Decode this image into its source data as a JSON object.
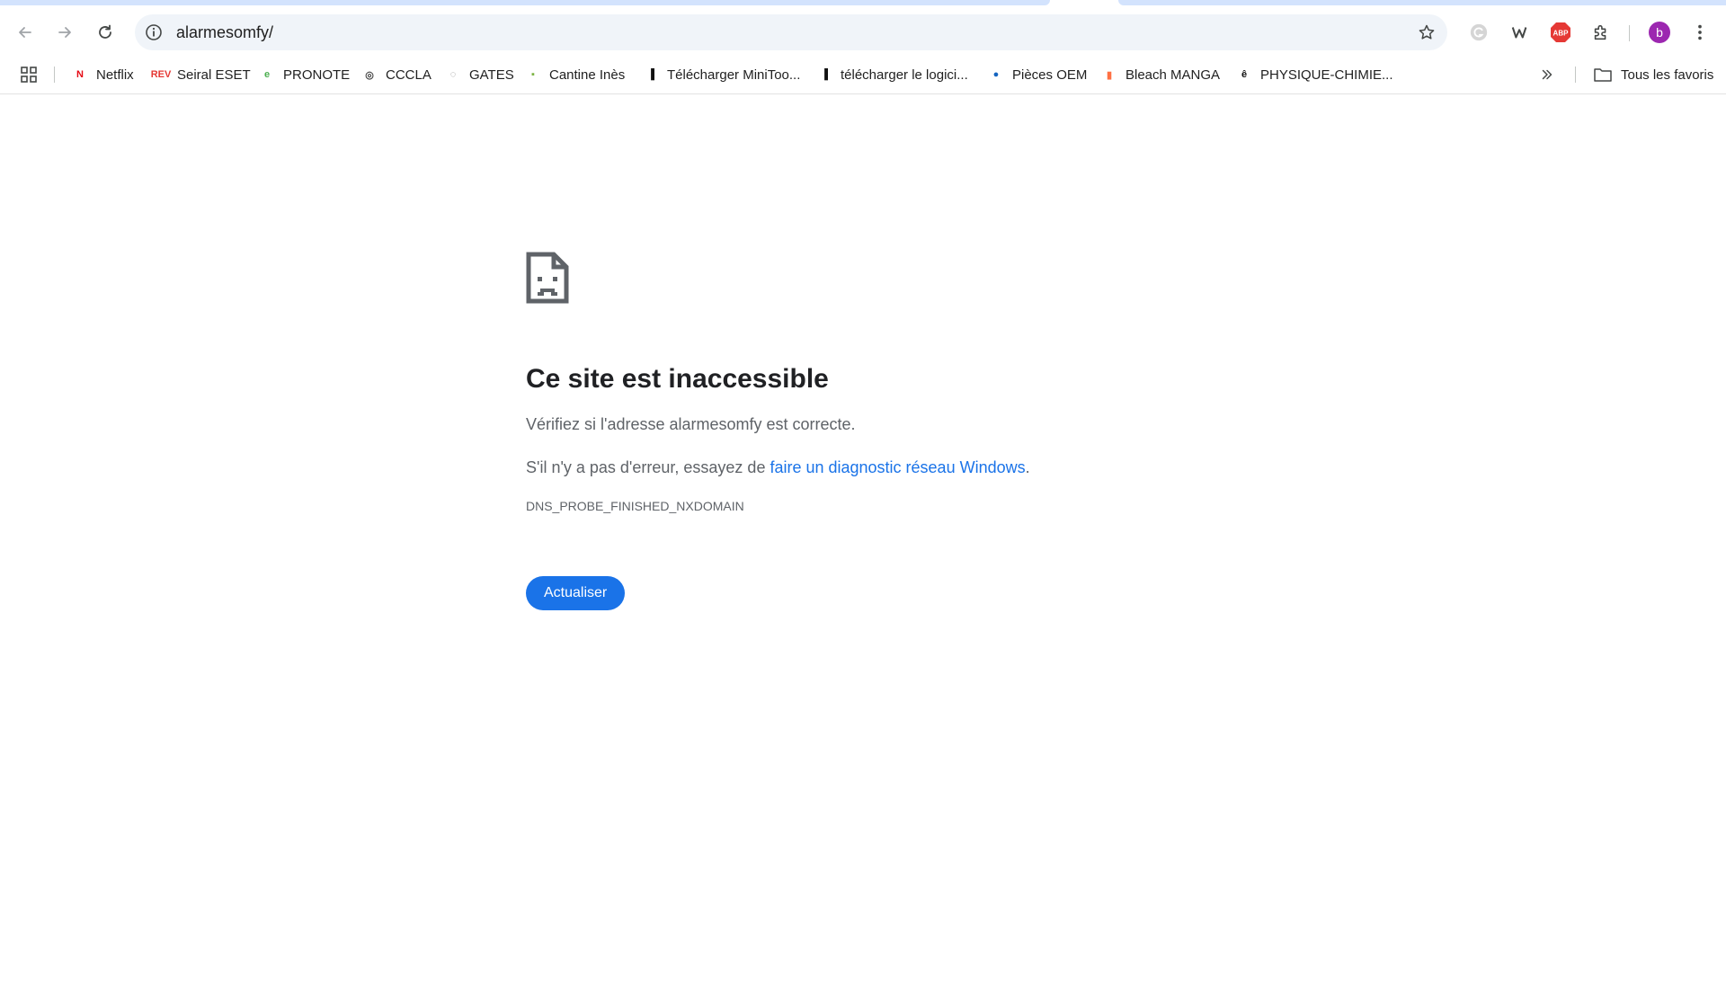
{
  "browser": {
    "url": "alarmesomfy/",
    "profile_initial": "b",
    "abp_label": "ABP"
  },
  "bookmarks": [
    {
      "label": "Netflix",
      "icon": "netflix-icon",
      "color": "#e50914",
      "glyph": "N"
    },
    {
      "label": "Seiral ESET",
      "icon": "rev-icon",
      "color": "#e53935",
      "glyph": "REV"
    },
    {
      "label": "PRONOTE",
      "icon": "pronote-icon",
      "color": "#4caf50",
      "glyph": "e"
    },
    {
      "label": "CCCLA",
      "icon": "cccla-icon",
      "color": "#444444",
      "glyph": "◎"
    },
    {
      "label": "GATES",
      "icon": "gates-icon",
      "color": "#888888",
      "glyph": "◌"
    },
    {
      "label": "Cantine Inès",
      "icon": "cantine-icon",
      "color": "#7cb342",
      "glyph": "▪"
    },
    {
      "label": "Télécharger MiniToo...",
      "icon": "minitool-icon",
      "color": "#111111",
      "glyph": "▐"
    },
    {
      "label": "télécharger le logici...",
      "icon": "logiciel-icon",
      "color": "#111111",
      "glyph": "▐"
    },
    {
      "label": "Pièces OEM",
      "icon": "oem-icon",
      "color": "#1565c0",
      "glyph": "●"
    },
    {
      "label": "Bleach MANGA",
      "icon": "bleach-icon",
      "color": "#ff7043",
      "glyph": "▮"
    },
    {
      "label": "PHYSIQUE-CHIMIE...",
      "icon": "physique-icon",
      "color": "#111111",
      "glyph": "ê"
    }
  ],
  "all_bookmarks_label": "Tous les favoris",
  "error": {
    "title": "Ce site est inaccessible",
    "line1": "Vérifiez si l'adresse alarmesomfy est correcte.",
    "line2_prefix": "S'il n'y a pas d'erreur, essayez de ",
    "line2_link": "faire un diagnostic réseau Windows",
    "line2_suffix": ".",
    "code": "DNS_PROBE_FINISHED_NXDOMAIN",
    "reload_label": "Actualiser"
  },
  "colors": {
    "accent": "#1a73e8",
    "omnibox_bg": "#f0f4f9",
    "profile": "#9c27b0",
    "abp": "#e53935"
  }
}
